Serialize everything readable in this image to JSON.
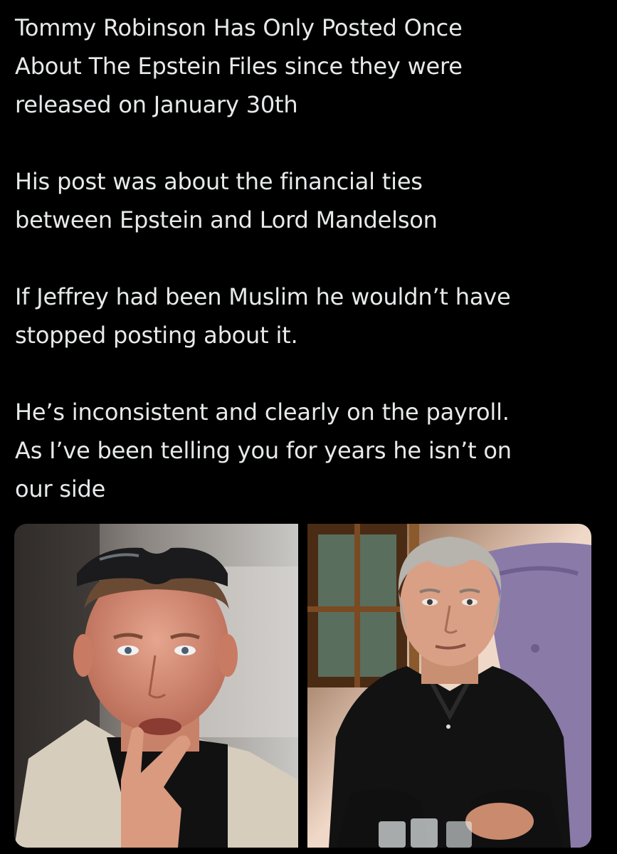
{
  "post": {
    "paragraphs": [
      [
        "Tommy Robinson Has Only Posted Once",
        "About The Epstein Files since they were",
        "released on January 30th"
      ],
      [
        "His post was about the financial ties",
        "between Epstein and Lord Mandelson"
      ],
      [
        "If Jeffrey had been Muslim he wouldn’t have",
        "stopped posting about it."
      ],
      [
        "He’s inconsistent and clearly on the payroll.",
        "As I’ve been telling you for years he isn’t on",
        "our side"
      ]
    ]
  },
  "media": {
    "images": [
      {
        "depicts": "man with sunglasses on head, fingers at mouth",
        "icon": "photo-icon"
      },
      {
        "depicts": "grey-haired man in black polo shirt seated in purple chair",
        "icon": "photo-icon"
      }
    ]
  },
  "colors": {
    "background": "#000000",
    "text": "#e7e9ea"
  }
}
